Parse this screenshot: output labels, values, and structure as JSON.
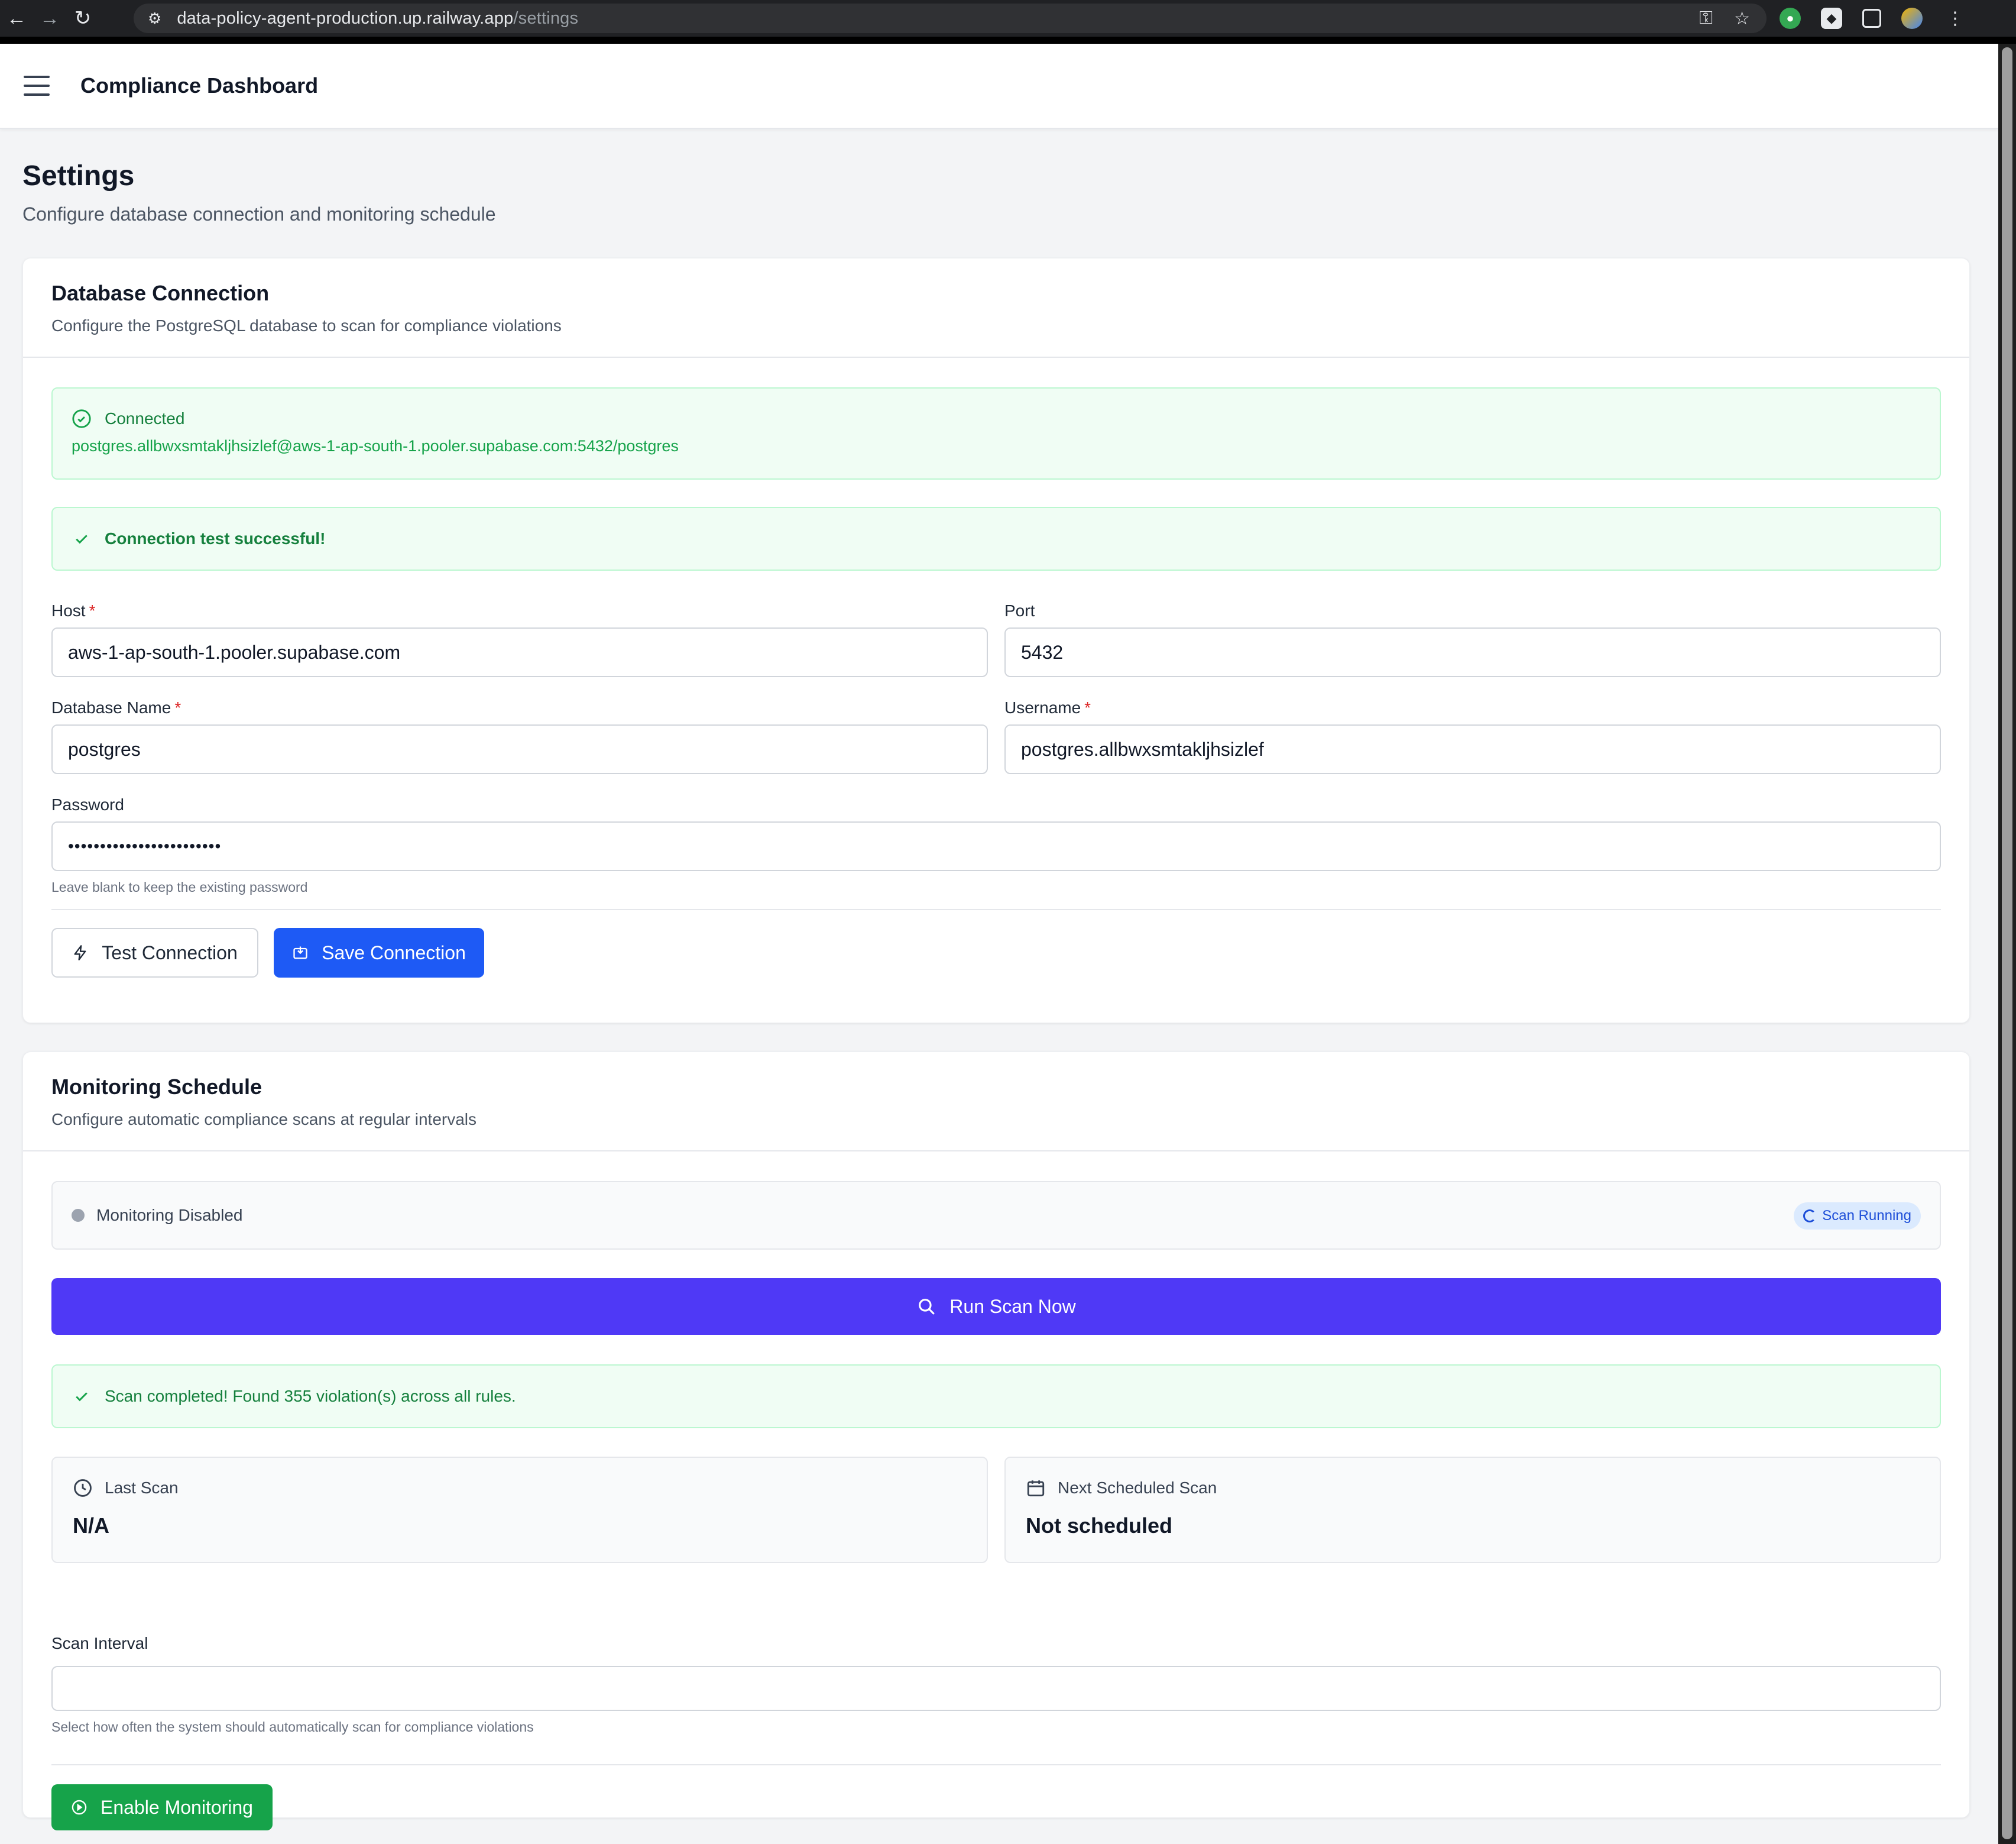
{
  "browser": {
    "url_host": "data-policy-agent-production.up.railway.app",
    "url_path": "/settings"
  },
  "header": {
    "title": "Compliance Dashboard"
  },
  "page": {
    "title": "Settings",
    "subtitle": "Configure database connection and monitoring schedule"
  },
  "database_card": {
    "title": "Database Connection",
    "description": "Configure the PostgreSQL database to scan for compliance violations",
    "status_label": "Connected",
    "status_connection_string": "postgres.allbwxsmtakljhsizlef@aws-1-ap-south-1.pooler.supabase.com:5432/postgres",
    "test_result": "Connection test successful!",
    "fields": {
      "host_label": "Host",
      "host_value": "aws-1-ap-south-1.pooler.supabase.com",
      "port_label": "Port",
      "port_value": "5432",
      "dbname_label": "Database Name",
      "dbname_value": "postgres",
      "username_label": "Username",
      "username_value": "postgres.allbwxsmtakljhsizlef",
      "password_label": "Password",
      "password_value": "••••••••••••••••••••••••",
      "password_hint": "Leave blank to keep the existing password",
      "required_marker": "*"
    },
    "test_button": "Test Connection",
    "save_button": "Save Connection"
  },
  "monitoring_card": {
    "title": "Monitoring Schedule",
    "description": "Configure automatic compliance scans at regular intervals",
    "status_text": "Monitoring Disabled",
    "running_badge": "Scan Running",
    "run_button": "Run Scan Now",
    "scan_result": "Scan completed! Found 355 violation(s) across all rules.",
    "last_scan_label": "Last Scan",
    "last_scan_value": "N/A",
    "next_scan_label": "Next Scheduled Scan",
    "next_scan_value": "Not scheduled",
    "interval_label": "Scan Interval",
    "interval_value": "",
    "interval_hint": "Select how often the system should automatically scan for compliance violations",
    "enable_button": "Enable Monitoring"
  },
  "colors": {
    "primary_blue": "#1e5af5",
    "indigo": "#4f39f6",
    "success_green": "#16a34a",
    "success_bg": "#f0fdf4",
    "page_bg": "#f3f4f6"
  }
}
